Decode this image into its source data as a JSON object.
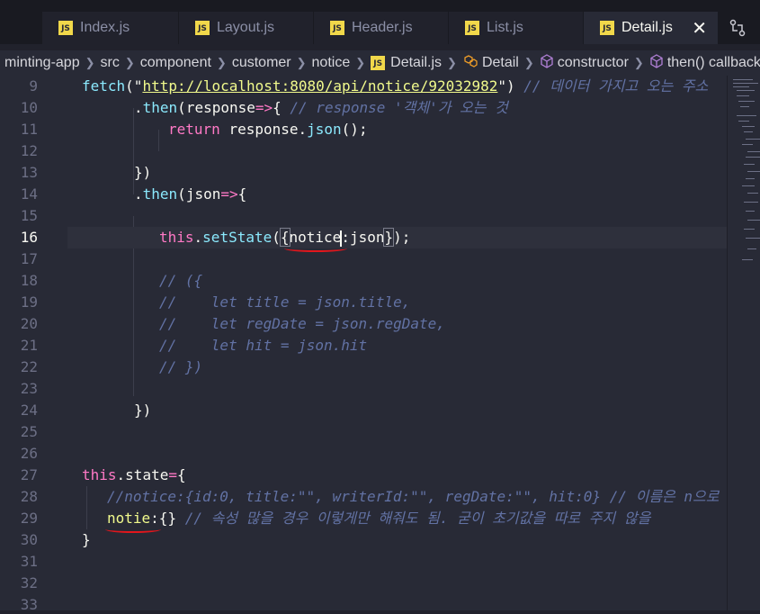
{
  "tabs": [
    {
      "label": "Index.js",
      "active": false
    },
    {
      "label": "Layout.js",
      "active": false
    },
    {
      "label": "Header.js",
      "active": false
    },
    {
      "label": "List.js",
      "active": false
    },
    {
      "label": "Detail.js",
      "active": true
    }
  ],
  "tab_close": "✕",
  "breadcrumb": [
    {
      "label": "minting-app",
      "icon": "none"
    },
    {
      "label": "src",
      "icon": "none"
    },
    {
      "label": "component",
      "icon": "none"
    },
    {
      "label": "customer",
      "icon": "none"
    },
    {
      "label": "notice",
      "icon": "none"
    },
    {
      "label": "Detail.js",
      "icon": "js-file-icon"
    },
    {
      "label": "Detail",
      "icon": "class-icon"
    },
    {
      "label": "constructor",
      "icon": "method-icon"
    },
    {
      "label": "then() callback",
      "icon": "method-icon"
    }
  ],
  "code": {
    "l9": {
      "num": "9",
      "fetch": "fetch",
      "url": "http://localhost:8080/api/notice/92032982",
      "comment": "// 데이터 가지고 오는 주소"
    },
    "l10": {
      "num": "10",
      "then": "then",
      "param": "response",
      "comment": "// response '객체'가 오는 것"
    },
    "l11": {
      "num": "11",
      "ret": "return",
      "obj": "response",
      "method": "json"
    },
    "l12": {
      "num": "12"
    },
    "l13": {
      "num": "13"
    },
    "l14": {
      "num": "14",
      "then": "then",
      "param": "json"
    },
    "l15": {
      "num": "15"
    },
    "l16": {
      "num": "16",
      "this": "this",
      "method": "setState",
      "key": "notice",
      "val": "json"
    },
    "l17": {
      "num": "17"
    },
    "l18": {
      "num": "18",
      "comment": "// ({"
    },
    "l19": {
      "num": "19",
      "comment": "//    let title = json.title,"
    },
    "l20": {
      "num": "20",
      "comment": "//    let regDate = json.regDate,"
    },
    "l21": {
      "num": "21",
      "comment": "//    let hit = json.hit"
    },
    "l22": {
      "num": "22",
      "comment": "// })"
    },
    "l23": {
      "num": "23"
    },
    "l24": {
      "num": "24"
    },
    "l25": {
      "num": "25"
    },
    "l26": {
      "num": "26"
    },
    "l27": {
      "num": "27",
      "this": "this",
      "prop": "state"
    },
    "l28": {
      "num": "28",
      "comment": "//notice:{id:0, title:\"\", writerId:\"\", regDate:\"\", hit:0} // 이름은 n으로"
    },
    "l29": {
      "num": "29",
      "key": "notie",
      "comment": "// 속성 많을 경우 이렇게만 해줘도 됨. 굳이 초기값을 따로 주지 않을"
    },
    "l30": {
      "num": "30"
    },
    "l31": {
      "num": "31"
    },
    "l32": {
      "num": "32"
    },
    "l33": {
      "num": "33"
    }
  },
  "colors": {
    "annotation": "#e3161c",
    "background": "#282a36"
  }
}
